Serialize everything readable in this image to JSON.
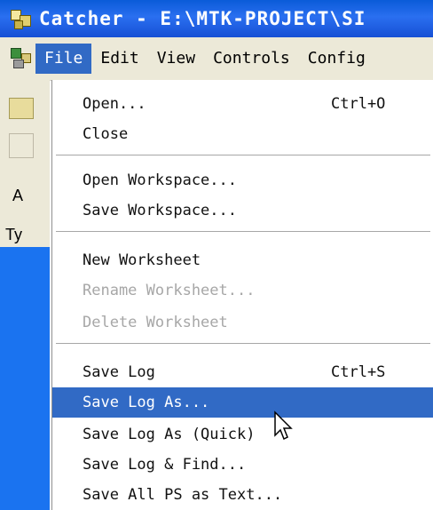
{
  "window": {
    "title": "Catcher - E:\\MTK-PROJECT\\SI"
  },
  "menubar": {
    "items": [
      {
        "label": "File",
        "active": true
      },
      {
        "label": "Edit"
      },
      {
        "label": "View"
      },
      {
        "label": "Controls"
      },
      {
        "label": "Config"
      }
    ]
  },
  "background_panel": {
    "button_label": "A",
    "column_header": "Ty"
  },
  "file_menu": {
    "items": [
      {
        "label": "Open...",
        "shortcut": "Ctrl+O"
      },
      {
        "label": "Close"
      },
      {
        "label": "Open Workspace..."
      },
      {
        "label": "Save Workspace..."
      },
      {
        "label": "New Worksheet"
      },
      {
        "label": "Rename Worksheet...",
        "disabled": true
      },
      {
        "label": "Delete Worksheet",
        "disabled": true
      },
      {
        "label": "Save Log",
        "shortcut": "Ctrl+S"
      },
      {
        "label": "Save Log As...",
        "selected": true
      },
      {
        "label": "Save Log As (Quick)"
      },
      {
        "label": "Save Log & Find..."
      },
      {
        "label": "Save All PS as Text..."
      }
    ]
  },
  "colors": {
    "title_bar": "#1650d4",
    "selection": "#316ac5",
    "background_pane": "#1a73f0"
  }
}
